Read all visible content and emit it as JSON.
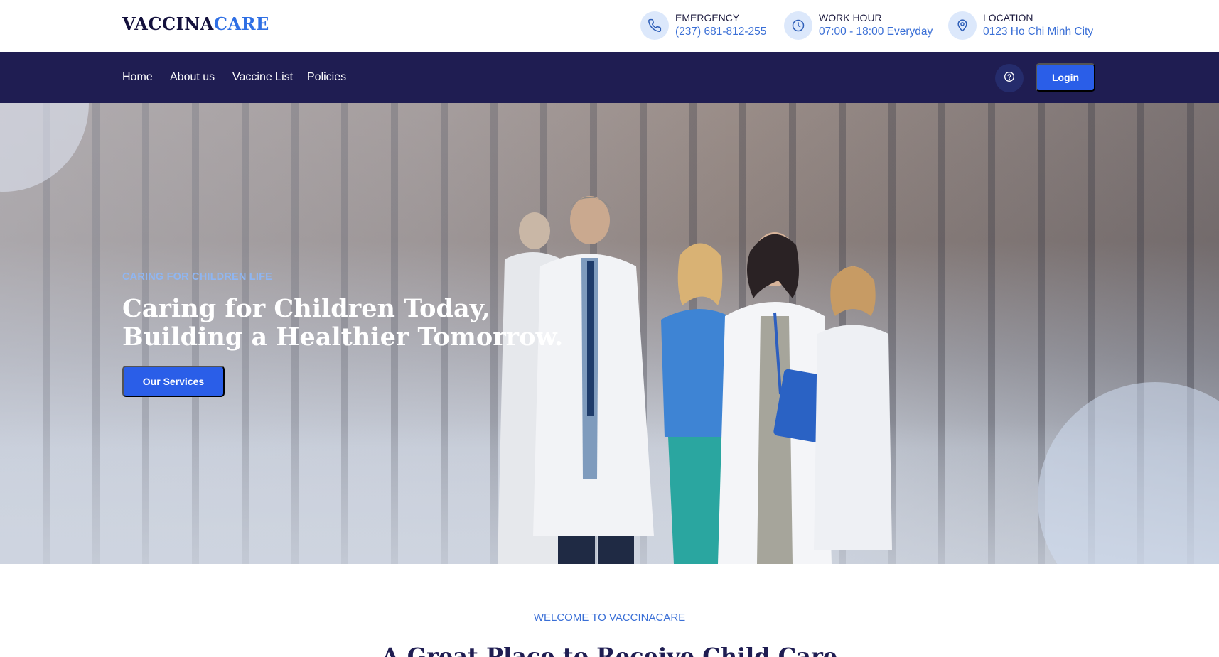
{
  "brand": {
    "name_part1": "VACCINA",
    "name_part2": "CARE"
  },
  "contact": {
    "emergency": {
      "label": "EMERGENCY",
      "value": "(237) 681-812-255",
      "icon": "phone-icon"
    },
    "work_hour": {
      "label": "WORK HOUR",
      "value": "07:00 - 18:00 Everyday",
      "icon": "clock-icon"
    },
    "location": {
      "label": "LOCATION",
      "value": "0123 Ho Chi Minh City",
      "icon": "map-pin-icon"
    }
  },
  "nav": {
    "items": [
      {
        "label": "Home"
      },
      {
        "label": "About us"
      },
      {
        "label": "Vaccine List"
      },
      {
        "label": "Policies"
      }
    ],
    "help_icon": "question-circle-icon",
    "login_label": "Login"
  },
  "hero": {
    "eyebrow": "CARING FOR CHILDREN LIFE",
    "title_line1": "Caring for Children Today,",
    "title_line2": "Building a Healthier Tomorrow.",
    "cta_label": "Our Services"
  },
  "welcome": {
    "eyebrow": "WELCOME TO VACCINACARE",
    "heading": "A Great Place to Receive Child Care"
  },
  "colors": {
    "navy": "#1f1d52",
    "accent_blue": "#2a5ee8",
    "link_blue": "#3a6fd6",
    "icon_circle": "#dce8fb"
  }
}
